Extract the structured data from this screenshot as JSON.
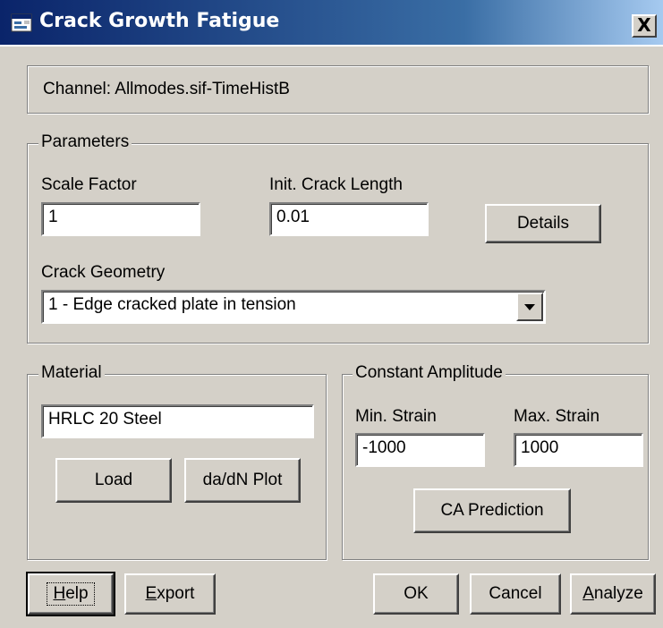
{
  "window": {
    "title": "Crack Growth Fatigue",
    "close_label": "X",
    "icons": {
      "app": "app-window-icon",
      "close": "close-icon",
      "dropdown": "chevron-down-icon"
    }
  },
  "channel": {
    "text": "Channel: Allmodes.sif-TimeHistB"
  },
  "parameters": {
    "group_label": "Parameters",
    "scale_factor": {
      "label": "Scale Factor",
      "value": "1"
    },
    "init_crack_length": {
      "label": "Init. Crack Length",
      "value": "0.01"
    },
    "details_button": "Details",
    "crack_geometry": {
      "label": "Crack Geometry",
      "selected": "1 - Edge cracked plate in tension"
    }
  },
  "material": {
    "group_label": "Material",
    "value": "HRLC 20 Steel",
    "load_button": "Load",
    "dadn_button": "da/dN Plot"
  },
  "constant_amplitude": {
    "group_label": "Constant Amplitude",
    "min_strain": {
      "label": "Min. Strain",
      "value": "-1000"
    },
    "max_strain": {
      "label": "Max. Strain",
      "value": "1000"
    },
    "prediction_button": "CA Prediction"
  },
  "footer": {
    "help": {
      "mnemonic": "H",
      "rest": "elp"
    },
    "export": {
      "mnemonic": "E",
      "rest": "xport"
    },
    "ok": "OK",
    "cancel": "Cancel",
    "analyze": {
      "mnemonic": "A",
      "rest": "nalyze"
    }
  }
}
